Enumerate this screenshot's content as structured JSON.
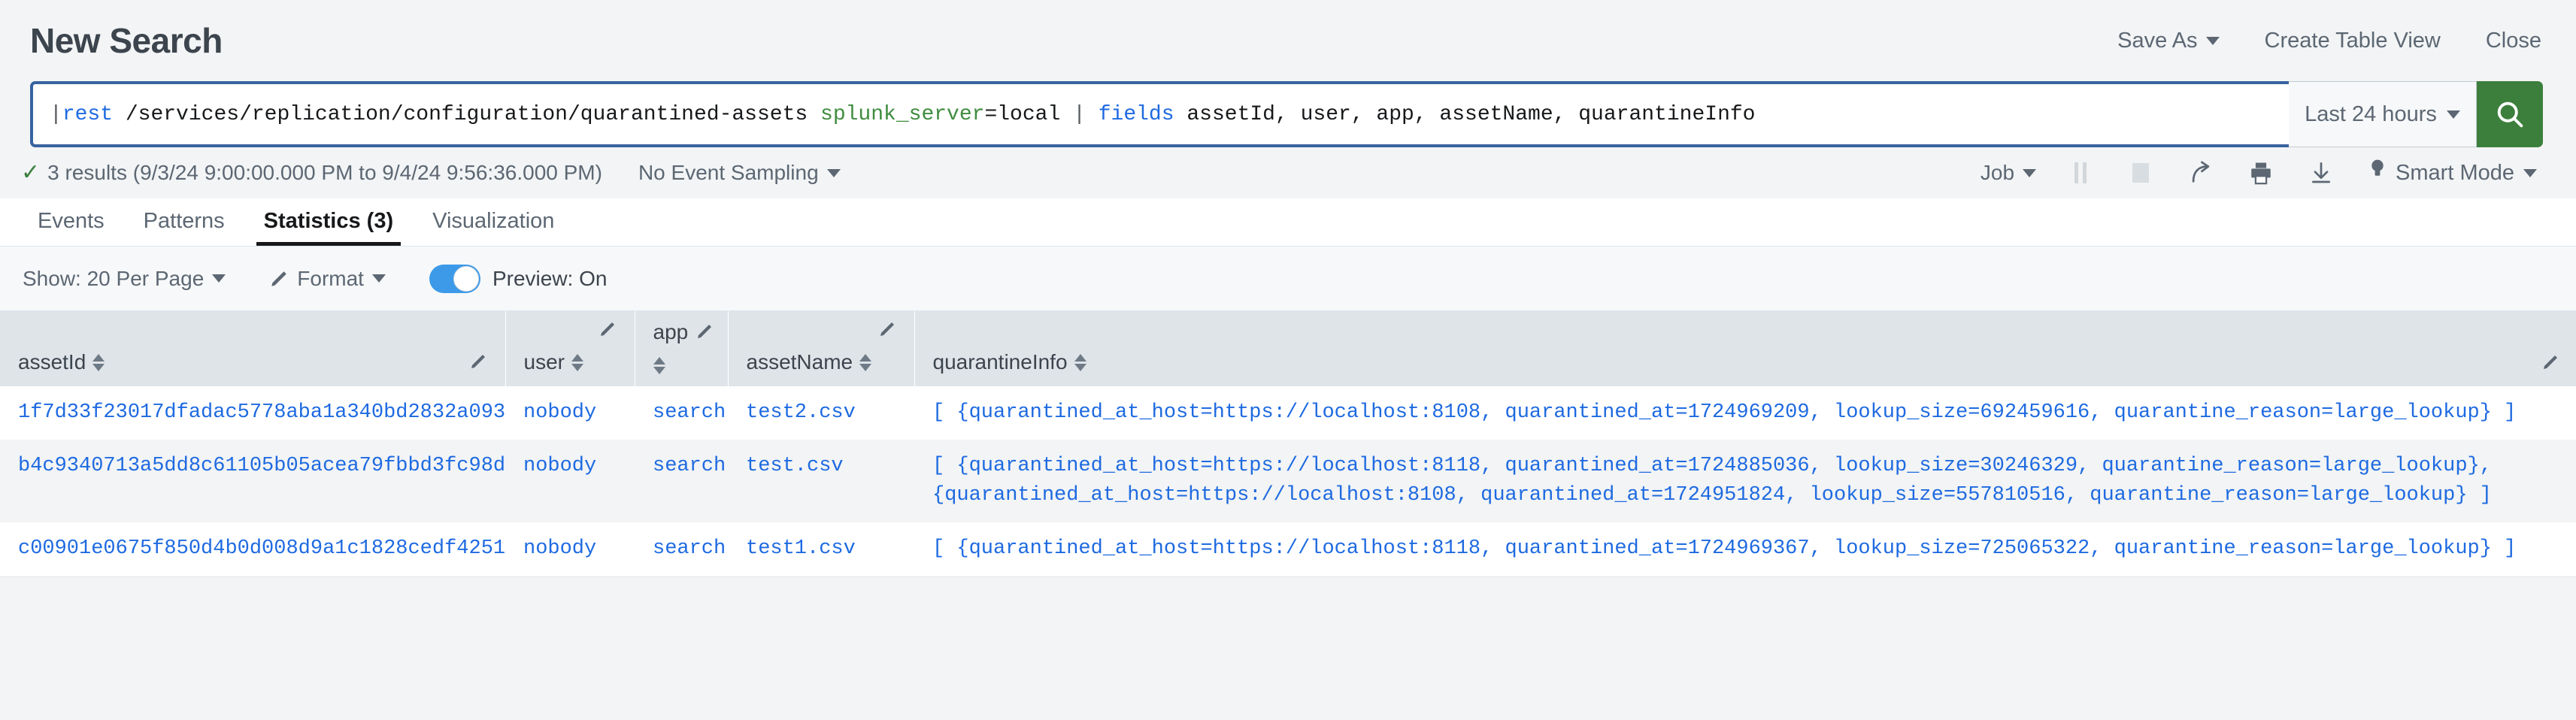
{
  "header": {
    "title": "New Search",
    "actions": [
      {
        "label": "Save As",
        "caret": true,
        "name": "save-as-button"
      },
      {
        "label": "Create Table View",
        "caret": false,
        "name": "create-table-view-button"
      },
      {
        "label": "Close",
        "caret": false,
        "name": "close-button"
      }
    ]
  },
  "search": {
    "query_full": "|rest /services/replication/configuration/quarantined-assets splunk_server=local | fields assetId, user, app, assetName, quarantineInfo",
    "tokens": {
      "pipe1": "|",
      "command": "rest",
      "path": "/services/replication/configuration/quarantined-assets",
      "arg_key": "splunk_server",
      "arg_value": "=local",
      "pipe2": "|",
      "command2": "fields",
      "fields": "assetId, user, app, assetName, quarantineInfo"
    },
    "time_range": "Last 24 hours",
    "search_icon": "search-icon",
    "accent_button": "#3c7f3c",
    "border_focus": "#3863a0"
  },
  "result_bar": {
    "status_icon": "check-icon",
    "result_text": "3 results (9/3/24 9:00:00.000 PM to 9/4/24 9:56:36.000 PM)",
    "sampling": "No Event Sampling",
    "job_label": "Job",
    "controls": [
      {
        "name": "pause-icon",
        "disabled": true
      },
      {
        "name": "stop-icon",
        "disabled": true
      },
      {
        "name": "share-icon",
        "disabled": false
      },
      {
        "name": "print-icon",
        "disabled": false
      },
      {
        "name": "export-icon",
        "disabled": false
      }
    ],
    "mode_icon": "lightbulb-icon",
    "mode_label": "Smart Mode"
  },
  "tabs": [
    {
      "label": "Events",
      "active": false,
      "name": "tab-events"
    },
    {
      "label": "Patterns",
      "active": false,
      "name": "tab-patterns"
    },
    {
      "label": "Statistics (3)",
      "active": true,
      "name": "tab-statistics"
    },
    {
      "label": "Visualization",
      "active": false,
      "name": "tab-visualization"
    }
  ],
  "toolbar": {
    "show_per_page": "Show: 20 Per Page",
    "format_label": "Format",
    "format_icon": "pencil-icon",
    "preview_label": "Preview: On",
    "preview_on": true,
    "toggle_color": "#3c9ae8"
  },
  "table": {
    "columns": [
      {
        "label": "assetId",
        "name": "column-header-assetid"
      },
      {
        "label": "user",
        "name": "column-header-user"
      },
      {
        "label": "app",
        "name": "column-header-app"
      },
      {
        "label": "assetName",
        "name": "column-header-assetname"
      },
      {
        "label": "quarantineInfo",
        "name": "column-header-quarantineinfo"
      }
    ],
    "rows": [
      {
        "assetId": "1f7d33f23017dfadac5778aba1a340bd2832a093",
        "user": "nobody",
        "app": "search",
        "assetName": "test2.csv",
        "quarantineInfo": [
          "[ {quarantined_at_host=https://localhost:8108, quarantined_at=1724969209, lookup_size=692459616, quarantine_reason=large_lookup} ]"
        ]
      },
      {
        "assetId": "b4c9340713a5dd8c61105b05acea79fbbd3fc98d",
        "user": "nobody",
        "app": "search",
        "assetName": "test.csv",
        "quarantineInfo": [
          "[ {quarantined_at_host=https://localhost:8118, quarantined_at=1724885036, lookup_size=30246329, quarantine_reason=large_lookup},",
          "{quarantined_at_host=https://localhost:8108, quarantined_at=1724951824, lookup_size=557810516, quarantine_reason=large_lookup} ]"
        ]
      },
      {
        "assetId": "c00901e0675f850d4b0d008d9a1c1828cedf4251",
        "user": "nobody",
        "app": "search",
        "assetName": "test1.csv",
        "quarantineInfo": [
          "[ {quarantined_at_host=https://localhost:8118, quarantined_at=1724969367, lookup_size=725065322, quarantine_reason=large_lookup} ]"
        ]
      }
    ]
  }
}
